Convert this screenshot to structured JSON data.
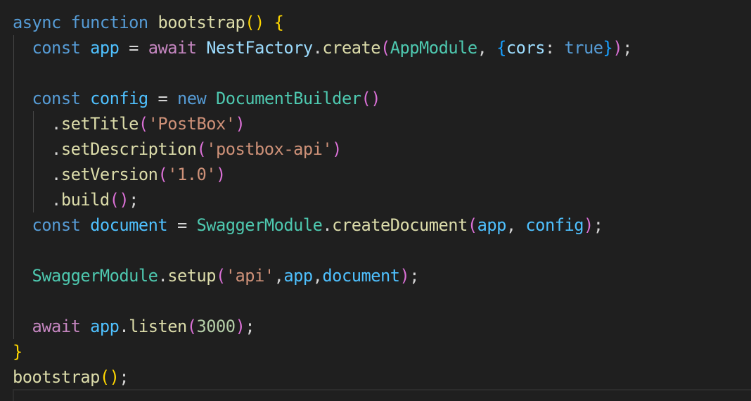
{
  "editor": {
    "lines": [
      [
        {
          "t": "async",
          "c": "tok-keyword-blue"
        },
        {
          "t": " ",
          "c": "tok-plain"
        },
        {
          "t": "function",
          "c": "tok-keyword-blue"
        },
        {
          "t": " ",
          "c": "tok-plain"
        },
        {
          "t": "bootstrap",
          "c": "tok-fn"
        },
        {
          "t": "()",
          "c": "b1"
        },
        {
          "t": " ",
          "c": "tok-plain"
        },
        {
          "t": "{",
          "c": "b1"
        }
      ],
      [
        {
          "t": "  ",
          "c": "tok-plain"
        },
        {
          "t": "const",
          "c": "tok-keyword-blue"
        },
        {
          "t": " ",
          "c": "tok-plain"
        },
        {
          "t": "app",
          "c": "tok-const"
        },
        {
          "t": " = ",
          "c": "tok-plain"
        },
        {
          "t": "await",
          "c": "tok-keyword-purple"
        },
        {
          "t": " ",
          "c": "tok-plain"
        },
        {
          "t": "NestFactory",
          "c": "tok-var"
        },
        {
          "t": ".",
          "c": "tok-plain"
        },
        {
          "t": "create",
          "c": "tok-fn"
        },
        {
          "t": "(",
          "c": "b2"
        },
        {
          "t": "AppModule",
          "c": "tok-class"
        },
        {
          "t": ", ",
          "c": "tok-plain"
        },
        {
          "t": "{",
          "c": "b3"
        },
        {
          "t": "cors",
          "c": "tok-var"
        },
        {
          "t": ": ",
          "c": "tok-plain"
        },
        {
          "t": "true",
          "c": "tok-keyword-blue"
        },
        {
          "t": "}",
          "c": "b3"
        },
        {
          "t": ")",
          "c": "b2"
        },
        {
          "t": ";",
          "c": "tok-plain"
        }
      ],
      [],
      [
        {
          "t": "  ",
          "c": "tok-plain"
        },
        {
          "t": "const",
          "c": "tok-keyword-blue"
        },
        {
          "t": " ",
          "c": "tok-plain"
        },
        {
          "t": "config",
          "c": "tok-const"
        },
        {
          "t": " = ",
          "c": "tok-plain"
        },
        {
          "t": "new",
          "c": "tok-keyword-blue"
        },
        {
          "t": " ",
          "c": "tok-plain"
        },
        {
          "t": "DocumentBuilder",
          "c": "tok-class"
        },
        {
          "t": "()",
          "c": "b2"
        }
      ],
      [
        {
          "t": "    .",
          "c": "tok-plain"
        },
        {
          "t": "setTitle",
          "c": "tok-fn"
        },
        {
          "t": "(",
          "c": "b2"
        },
        {
          "t": "'PostBox'",
          "c": "tok-str"
        },
        {
          "t": ")",
          "c": "b2"
        }
      ],
      [
        {
          "t": "    .",
          "c": "tok-plain"
        },
        {
          "t": "setDescription",
          "c": "tok-fn"
        },
        {
          "t": "(",
          "c": "b2"
        },
        {
          "t": "'postbox-api'",
          "c": "tok-str"
        },
        {
          "t": ")",
          "c": "b2"
        }
      ],
      [
        {
          "t": "    .",
          "c": "tok-plain"
        },
        {
          "t": "setVersion",
          "c": "tok-fn"
        },
        {
          "t": "(",
          "c": "b2"
        },
        {
          "t": "'1.0'",
          "c": "tok-str"
        },
        {
          "t": ")",
          "c": "b2"
        }
      ],
      [
        {
          "t": "    .",
          "c": "tok-plain"
        },
        {
          "t": "build",
          "c": "tok-fn"
        },
        {
          "t": "()",
          "c": "b2"
        },
        {
          "t": ";",
          "c": "tok-plain"
        }
      ],
      [
        {
          "t": "  ",
          "c": "tok-plain"
        },
        {
          "t": "const",
          "c": "tok-keyword-blue"
        },
        {
          "t": " ",
          "c": "tok-plain"
        },
        {
          "t": "document",
          "c": "tok-const"
        },
        {
          "t": " = ",
          "c": "tok-plain"
        },
        {
          "t": "SwaggerModule",
          "c": "tok-class"
        },
        {
          "t": ".",
          "c": "tok-plain"
        },
        {
          "t": "createDocument",
          "c": "tok-fn"
        },
        {
          "t": "(",
          "c": "b2"
        },
        {
          "t": "app",
          "c": "tok-const"
        },
        {
          "t": ", ",
          "c": "tok-plain"
        },
        {
          "t": "config",
          "c": "tok-const"
        },
        {
          "t": ")",
          "c": "b2"
        },
        {
          "t": ";",
          "c": "tok-plain"
        }
      ],
      [],
      [
        {
          "t": "  ",
          "c": "tok-plain"
        },
        {
          "t": "SwaggerModule",
          "c": "tok-class"
        },
        {
          "t": ".",
          "c": "tok-plain"
        },
        {
          "t": "setup",
          "c": "tok-fn"
        },
        {
          "t": "(",
          "c": "b2"
        },
        {
          "t": "'api'",
          "c": "tok-str"
        },
        {
          "t": ",",
          "c": "tok-plain"
        },
        {
          "t": "app",
          "c": "tok-const"
        },
        {
          "t": ",",
          "c": "tok-plain"
        },
        {
          "t": "document",
          "c": "tok-const"
        },
        {
          "t": ")",
          "c": "b2"
        },
        {
          "t": ";",
          "c": "tok-plain"
        }
      ],
      [],
      [
        {
          "t": "  ",
          "c": "tok-plain"
        },
        {
          "t": "await",
          "c": "tok-keyword-purple"
        },
        {
          "t": " ",
          "c": "tok-plain"
        },
        {
          "t": "app",
          "c": "tok-const"
        },
        {
          "t": ".",
          "c": "tok-plain"
        },
        {
          "t": "listen",
          "c": "tok-fn"
        },
        {
          "t": "(",
          "c": "b2"
        },
        {
          "t": "3000",
          "c": "tok-num"
        },
        {
          "t": ")",
          "c": "b2"
        },
        {
          "t": ";",
          "c": "tok-plain"
        }
      ],
      [
        {
          "t": "}",
          "c": "b1"
        }
      ],
      [
        {
          "t": "bootstrap",
          "c": "tok-fn"
        },
        {
          "t": "()",
          "c": "b1"
        },
        {
          "t": ";",
          "c": "tok-plain"
        }
      ]
    ]
  }
}
